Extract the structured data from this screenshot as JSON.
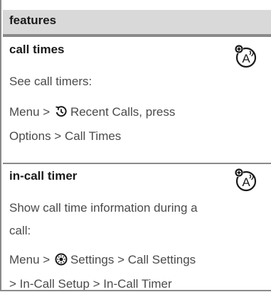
{
  "header": {
    "title": "features"
  },
  "features": [
    {
      "title": "call times",
      "description": "See call timers:",
      "path_line1": {
        "menu": "Menu",
        "sep": ">",
        "item": "Recent Calls, press",
        "icon": "recent-calls-icon"
      },
      "path_line2": "Options > Call Times",
      "badge_icon": "network-dependent-feature-icon",
      "badge_text": "A"
    },
    {
      "title": "in-call timer",
      "description_line1": "Show call time information during a",
      "description_line2": "call:",
      "path_line1": {
        "menu": "Menu",
        "sep": ">",
        "item": "Settings > Call Settings",
        "icon": "settings-icon"
      },
      "path_line2": "> In-Call Setup > In-Call Timer",
      "badge_icon": "network-dependent-feature-icon",
      "badge_text": "A"
    }
  ]
}
